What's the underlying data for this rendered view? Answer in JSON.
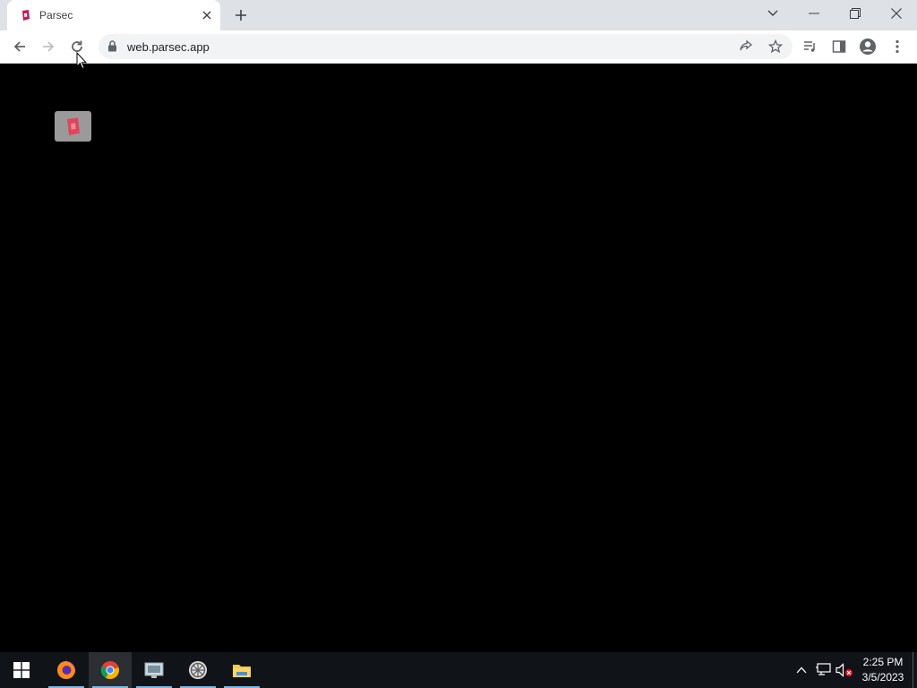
{
  "browser": {
    "tab": {
      "title": "Parsec",
      "favicon": "parsec-logo-icon"
    },
    "address_bar": {
      "url": "web.parsec.app"
    },
    "toolbar_icons": [
      "back-icon",
      "forward-icon",
      "reload-icon",
      "lock-icon",
      "share-icon",
      "bookmark-star-icon",
      "media-control-icon",
      "side-panel-icon",
      "profile-icon",
      "menu-icon"
    ],
    "window_controls": [
      "tab-search-icon",
      "minimize-icon",
      "restore-icon",
      "close-icon"
    ]
  },
  "page": {
    "background": "#000000",
    "loading_logo": "parsec-logo-icon",
    "accent": "#e0455a"
  },
  "taskbar": {
    "apps": [
      {
        "name": "start-icon",
        "active": false
      },
      {
        "name": "firefox-icon",
        "active": false
      },
      {
        "name": "chrome-icon",
        "active": true
      },
      {
        "name": "network-app-icon",
        "active": false
      },
      {
        "name": "wheel-app-icon",
        "active": false
      },
      {
        "name": "file-explorer-icon",
        "active": false
      }
    ],
    "tray_icons": [
      "chevron-up-icon",
      "network-icon",
      "volume-muted-icon"
    ],
    "clock": {
      "time": "2:25 PM",
      "date": "3/5/2023"
    }
  }
}
